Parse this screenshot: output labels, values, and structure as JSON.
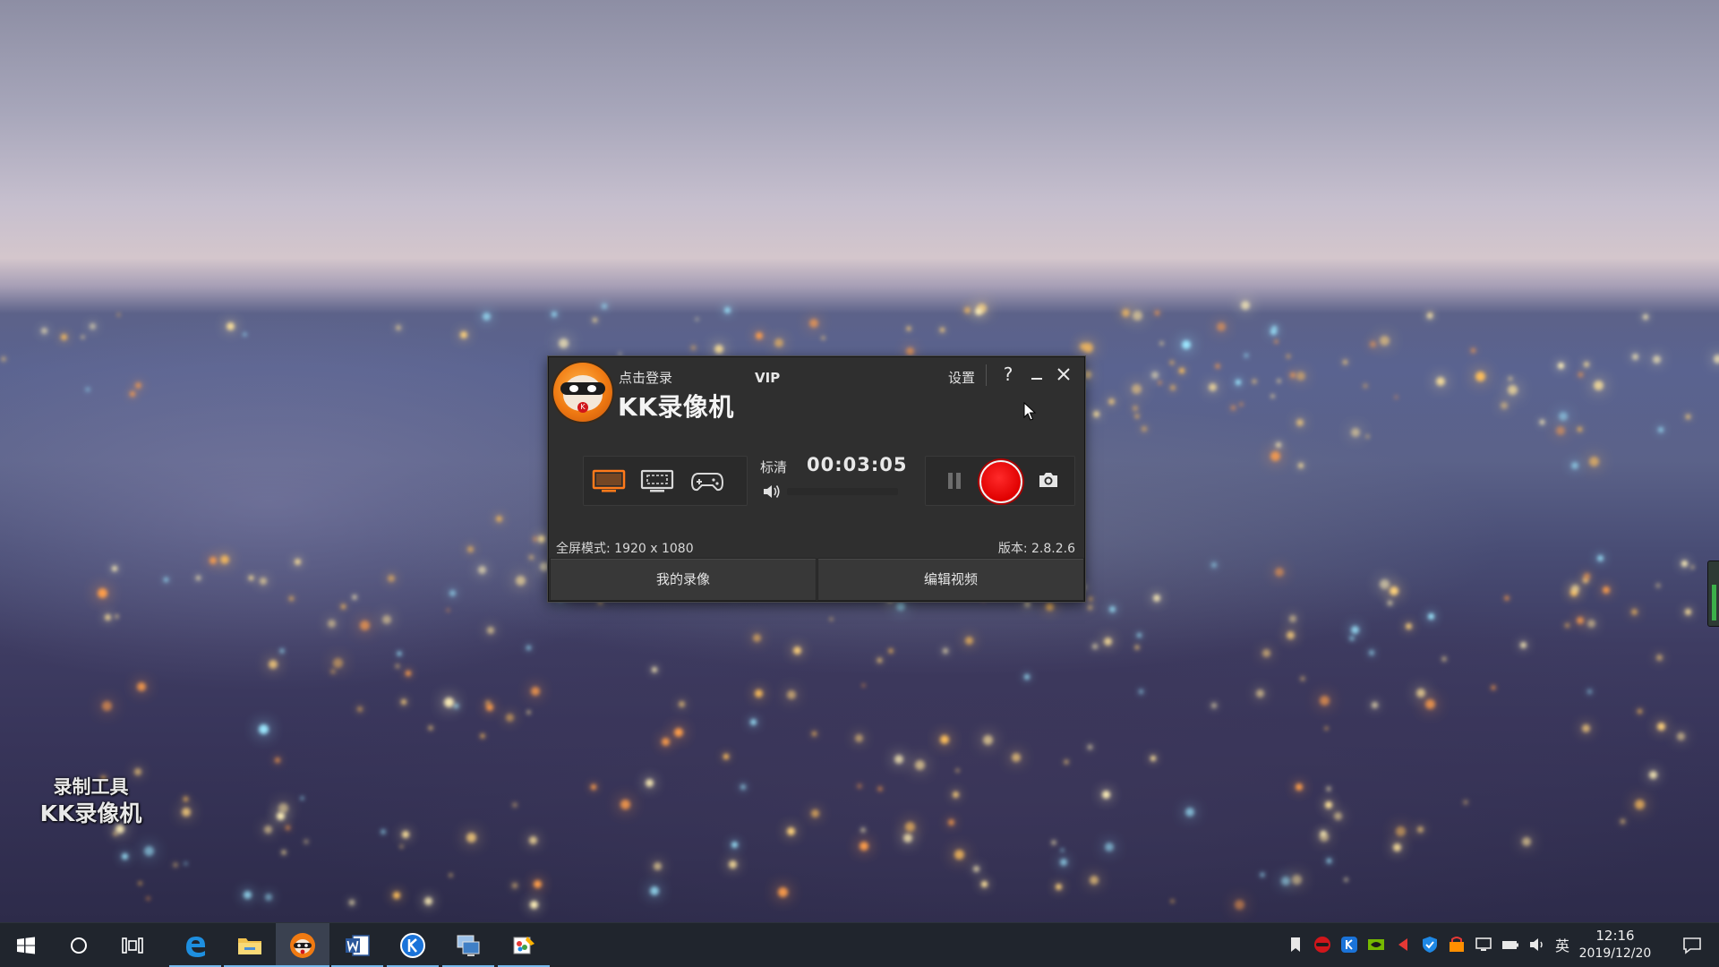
{
  "desktop": {
    "watermark": {
      "line1": "录制工具",
      "line2": "KK录像机"
    }
  },
  "kk_window": {
    "login_label": "点击登录",
    "vip_label": "VIP",
    "title": "KK录像机",
    "settings_label": "设置",
    "help_label": "?",
    "minimize_label": "–",
    "close_label": "✕",
    "quality_label": "标清",
    "timer": "00:03:05",
    "mode_info": "全屏模式: 1920 x 1080",
    "version_info": "版本: 2.8.2.6",
    "my_recordings_label": "我的录像",
    "edit_video_label": "编辑视频",
    "active_mode": "fullscreen",
    "colors": {
      "active_mode": "#ff7a1a",
      "inactive_mode": "#d8d8d8",
      "record": "#e00000",
      "window_bg": "#2f2f2f"
    }
  },
  "taskbar": {
    "apps": [
      "windows-start",
      "cortana-search",
      "task-view",
      "edge",
      "file-explorer",
      "kk-recorder",
      "word",
      "k-app",
      "remote-desktop",
      "paint-app"
    ],
    "ime_label": "英",
    "clock_time": "12:16",
    "clock_date": "2019/12/20",
    "colors": {
      "bg": "#20252d",
      "open_indicator": "#76b9ed"
    }
  }
}
